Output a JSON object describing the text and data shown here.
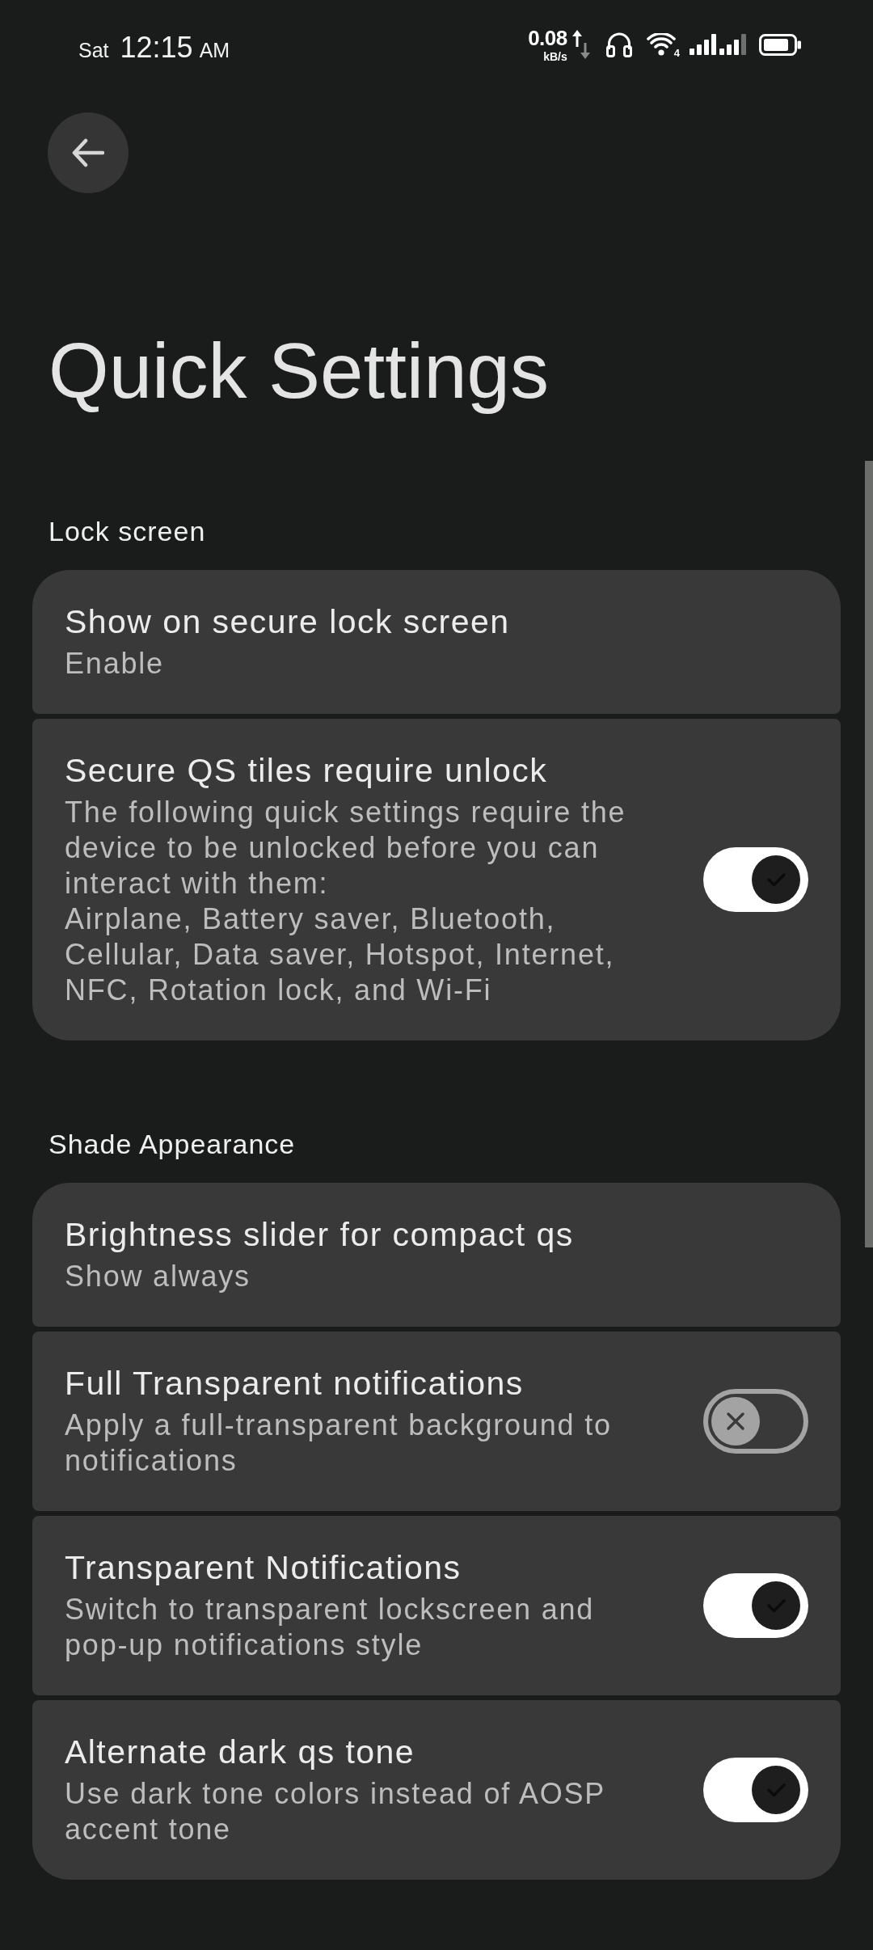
{
  "status_bar": {
    "day": "Sat",
    "time": "12:15",
    "meridiem": "AM",
    "net_speed": "0.08",
    "net_unit": "kB/s",
    "wifi_label": "4"
  },
  "title": "Quick Settings",
  "sections": [
    {
      "heading": "Lock screen",
      "items": [
        {
          "kind": "value",
          "title": "Show on secure lock screen",
          "summary": "Enable"
        },
        {
          "kind": "switch",
          "title": "Secure QS tiles require unlock",
          "summary": "The following quick settings require the device to be unlocked before you can interact with them:\nAirplane, Battery saver, Bluetooth, Cellular, Data saver, Hotspot, Internet, NFC, Rotation lock, and Wi-Fi",
          "on": true
        }
      ]
    },
    {
      "heading": "Shade Appearance",
      "items": [
        {
          "kind": "value",
          "title": "Brightness slider for compact qs",
          "summary": "Show always"
        },
        {
          "kind": "switch",
          "title": "Full Transparent notifications",
          "summary": "Apply a full-transparent background to notifications",
          "on": false
        },
        {
          "kind": "switch",
          "title": "Transparent Notifications",
          "summary": "Switch to transparent lockscreen and pop-up notifications style",
          "on": true
        },
        {
          "kind": "switch",
          "title": "Alternate dark qs tone",
          "summary": "Use dark tone colors instead of AOSP accent tone",
          "on": true
        }
      ]
    }
  ]
}
